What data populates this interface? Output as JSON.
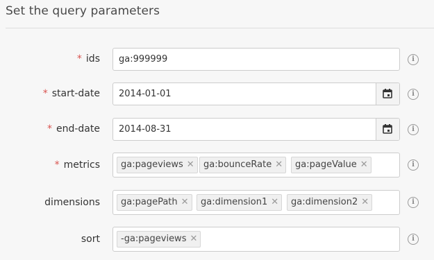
{
  "header": {
    "title": "Set the query parameters"
  },
  "required_marker": "*",
  "info_glyph": "i",
  "remove_glyph": "✕",
  "fields": {
    "ids": {
      "label": "ids",
      "value": "ga:999999",
      "required": true
    },
    "start_date": {
      "label": "start-date",
      "value": "2014-01-01",
      "required": true
    },
    "end_date": {
      "label": "end-date",
      "value": "2014-08-31",
      "required": true
    },
    "metrics": {
      "label": "metrics",
      "required": true,
      "tags": [
        "ga:pageviews",
        "ga:bounceRate",
        "ga:pageValue"
      ]
    },
    "dimensions": {
      "label": "dimensions",
      "required": false,
      "tags": [
        "ga:pagePath",
        "ga:dimension1",
        "ga:dimension2"
      ]
    },
    "sort": {
      "label": "sort",
      "required": false,
      "tags": [
        "-ga:pageviews"
      ]
    }
  },
  "icons": {
    "calendar": "calendar-icon",
    "info": "info-icon",
    "remove": "remove-tag-icon"
  },
  "colors": {
    "required": "#d9534f",
    "border": "#cccccc",
    "tag_bg": "#f0f0f0"
  }
}
